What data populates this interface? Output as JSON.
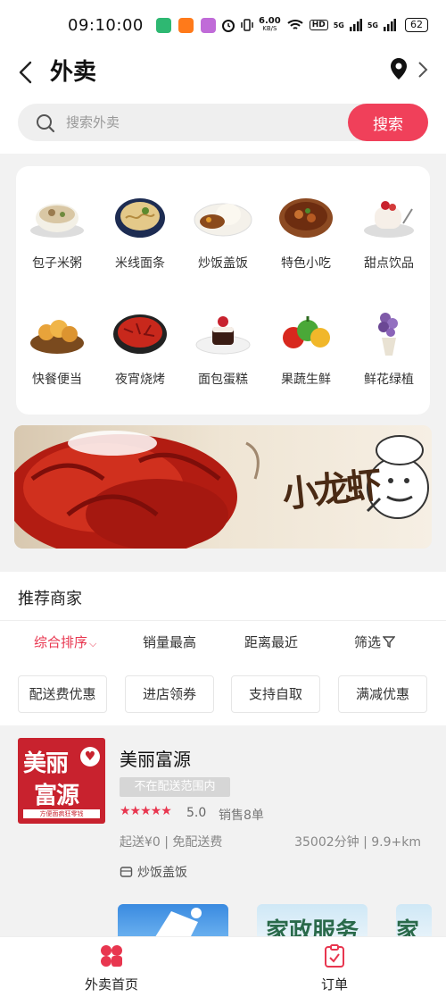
{
  "status_bar": {
    "time": "09:10:00",
    "net_speed": "6.00",
    "net_unit": "KB/S",
    "hd": "HD",
    "sig1": "5G",
    "sig2": "5G",
    "battery": "62"
  },
  "header": {
    "title": "外卖"
  },
  "search": {
    "placeholder": "搜索外卖",
    "button": "搜索"
  },
  "categories": [
    {
      "label": "包子米粥",
      "icon": "congee-icon"
    },
    {
      "label": "米线面条",
      "icon": "noodle-icon"
    },
    {
      "label": "炒饭盖饭",
      "icon": "rice-icon"
    },
    {
      "label": "特色小吃",
      "icon": "snack-icon"
    },
    {
      "label": "甜点饮品",
      "icon": "dessert-icon"
    },
    {
      "label": "快餐便当",
      "icon": "fastfood-icon"
    },
    {
      "label": "夜宵烧烤",
      "icon": "crayfish-icon"
    },
    {
      "label": "面包蛋糕",
      "icon": "cake-icon"
    },
    {
      "label": "果蔬生鲜",
      "icon": "vegetable-icon"
    },
    {
      "label": "鲜花绿植",
      "icon": "flower-icon"
    }
  ],
  "banner": {
    "text": "小龙虾"
  },
  "recommend": {
    "title": "推荐商家",
    "sorts": [
      "综合排序",
      "销量最高",
      "距离最近",
      "筛选"
    ],
    "tags": [
      "配送费优惠",
      "进店领券",
      "支持自取",
      "满减优惠"
    ]
  },
  "shop": {
    "logo_text1": "美丽",
    "logo_text2": "富源",
    "logo_sub": "方便面疯狂零钱",
    "name": "美丽富源",
    "badge": "不在配送范围内",
    "stars": "★★★★★",
    "rating": "5.0",
    "sales": "销售8单",
    "delivery": "起送¥0 | 免配送费",
    "distance": "35002分钟 | 9.9+km",
    "category": "炒饭盖饭",
    "thumb2_text": "家政服务",
    "thumb3_text": "家"
  },
  "bottom_nav": [
    {
      "label": "外卖首页",
      "icon": "home-grid-icon"
    },
    {
      "label": "订单",
      "icon": "order-clipboard-icon"
    }
  ],
  "colors": {
    "accent": "#e8364f",
    "search_btn": "#f0405a",
    "logo_red": "#c8222e"
  }
}
